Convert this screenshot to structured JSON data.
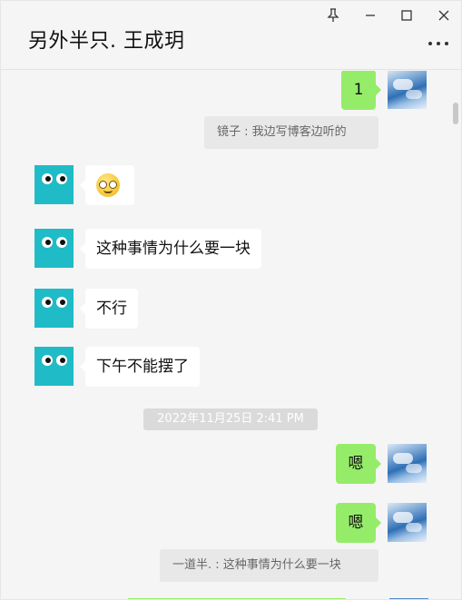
{
  "window": {
    "title": "另外半只. 王成玥",
    "controls": {
      "pin": "pin-icon",
      "minimize": "minimize-icon",
      "maximize": "maximize-icon",
      "close": "close-icon",
      "more": "more-icon"
    }
  },
  "messages": [
    {
      "type": "out",
      "text": "1"
    },
    {
      "type": "quote",
      "text": "镜子 : 我边写博客边听的"
    },
    {
      "type": "in",
      "emoji": "grinning-face-with-glasses-emoji"
    },
    {
      "type": "in",
      "text": "这种事情为什么要一块"
    },
    {
      "type": "in",
      "text": "不行"
    },
    {
      "type": "in",
      "text": "下午不能摆了"
    },
    {
      "type": "time",
      "text": "2022年11月25日 2:41 PM"
    },
    {
      "type": "out",
      "text": "嗯"
    },
    {
      "type": "out",
      "text": "嗯"
    },
    {
      "type": "quote",
      "text": "一道半. : 这种事情为什么要一块"
    }
  ],
  "colors": {
    "bubble_out": "#95ec69",
    "bubble_in": "#ffffff",
    "avatar_in": "#1fbcc7",
    "background": "#f5f5f5"
  }
}
